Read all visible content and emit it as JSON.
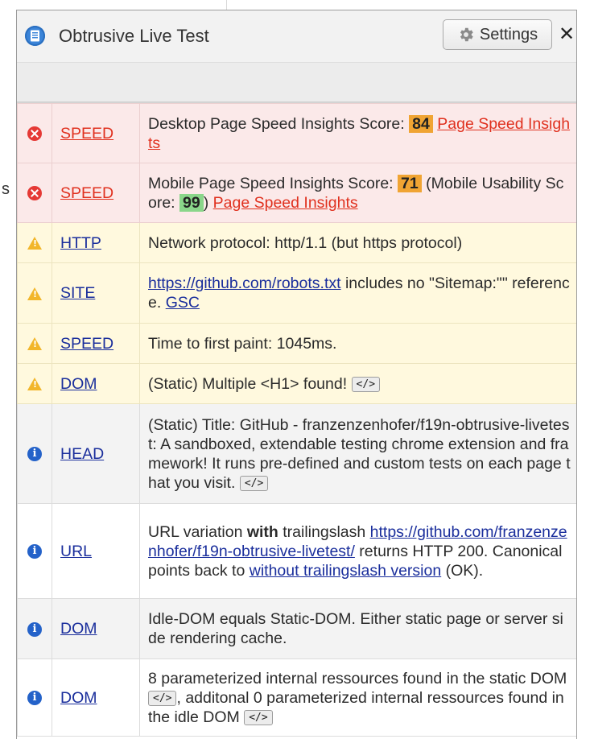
{
  "window": {
    "title": "Obtrusive Live Test",
    "settings_label": "Settings",
    "close_glyph": "✕"
  },
  "background": {
    "cut_char": "s"
  },
  "rows": [
    {
      "level": "error",
      "category": "SPEED",
      "text_a": "Desktop Page Speed Insights Score: ",
      "score": "84",
      "link": "Page Speed Insights"
    },
    {
      "level": "error",
      "category": "SPEED",
      "text_a": "Mobile Page Speed Insights Score: ",
      "score": "71",
      "text_b": " (Mobile Usability Score: ",
      "score2": "99",
      "text_c": ") ",
      "link": "Page Speed Insights"
    },
    {
      "level": "warning",
      "category": "HTTP",
      "text_a": "Network protocol: http/1.1 (but https protocol)"
    },
    {
      "level": "warning",
      "category": "SITE",
      "link": "https://github.com/robots.txt",
      "text_a": " includes no \"Sitemap:\"\" reference. ",
      "link2": "GSC"
    },
    {
      "level": "warning",
      "category": "SPEED",
      "text_a": "Time to first paint: 1045ms."
    },
    {
      "level": "warning",
      "category": "DOM",
      "text_a": "(Static) Multiple <H1> found! ",
      "code": "</>"
    },
    {
      "level": "info",
      "category": "HEAD",
      "text_a": "(Static) Title: GitHub - franzenzenhofer/f19n-obtrusive-livetest: A sandboxed, extendable testing chrome extension and framework! It runs pre-defined and custom tests on each page that you visit. ",
      "code": "</>"
    },
    {
      "level": "info",
      "category": "URL",
      "text_a": "URL variation ",
      "bold": "with",
      "text_b": " trailingslash ",
      "link": "https://github.com/franzenzenhofer/f19n-obtrusive-livetest/",
      "text_c": " returns HTTP 200. Canonical points back to ",
      "link2": "without trailingslash version",
      "text_d": " (OK)."
    },
    {
      "level": "info",
      "category": "DOM",
      "text_a": "Idle-DOM equals Static-DOM. Either static page or server side rendering cache."
    },
    {
      "level": "info",
      "category": "DOM",
      "text_a": "8 parameterized internal ressources found in the static DOM ",
      "code": "</>",
      "text_b": ", additonal 0 parameterized internal ressources found in the idle DOM ",
      "code2": "</>"
    }
  ],
  "colors": {
    "error": "#e53935",
    "warning": "#f2b62a",
    "info": "#2462c9"
  },
  "icons": {
    "error": "x-circle-icon",
    "warning": "warning-triangle-icon",
    "info": "info-circle-icon",
    "app": "document-icon",
    "settings": "gear-icon"
  }
}
